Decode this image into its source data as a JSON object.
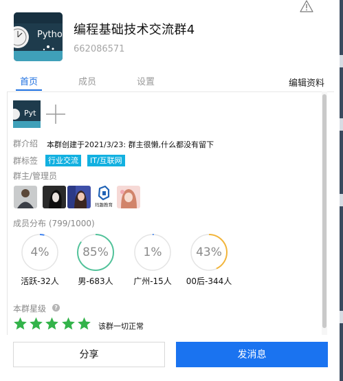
{
  "header": {
    "title": "编程基础技术交流群4",
    "group_id": "662086571",
    "avatar_text": "Pytho"
  },
  "tabs": [
    {
      "label": "首页",
      "active": true
    },
    {
      "label": "成员",
      "active": false
    },
    {
      "label": "设置",
      "active": false
    }
  ],
  "edit_label": "编辑资料",
  "photos": {
    "thumb_text": "Pyt"
  },
  "intro": {
    "label": "群介绍",
    "text": "本群创建于2021/3/23:  群主很懒,什么都没有留下"
  },
  "tags": {
    "label": "群标签",
    "items": [
      "行业交流",
      "IT/互联网"
    ]
  },
  "admins": {
    "label": "群主/管理员",
    "logo_text": "玛趣教育"
  },
  "distribution": {
    "label": "成员分布",
    "count_text": "(799/1000)",
    "items": [
      {
        "percent": "4%",
        "value": 4,
        "label": "活跃-32人",
        "color": "#3f83f0"
      },
      {
        "percent": "85%",
        "value": 85,
        "label": "男-683人",
        "color": "#52c29a"
      },
      {
        "percent": "1%",
        "value": 1,
        "label": "广州-15人",
        "color": "#3f83f0"
      },
      {
        "percent": "43%",
        "value": 43,
        "label": "00后-344人",
        "color": "#f2b53a"
      }
    ]
  },
  "rating": {
    "label": "本群星级",
    "stars": 5,
    "status_text": "该群一切正常",
    "color": "#33b34a"
  },
  "buttons": {
    "share": "分享",
    "send": "发消息"
  }
}
